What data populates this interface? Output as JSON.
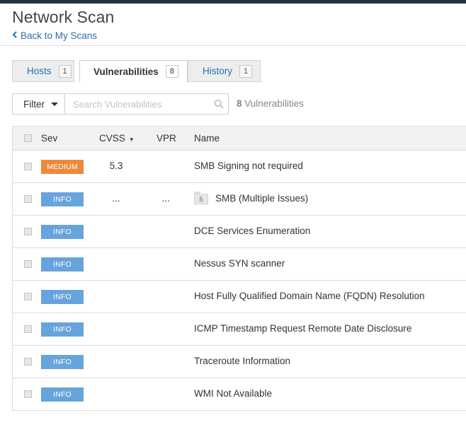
{
  "page": {
    "title": "Network Scan",
    "back_link": "Back to My Scans"
  },
  "tabs": [
    {
      "label": "Hosts",
      "count": "1",
      "active": false
    },
    {
      "label": "Vulnerabilities",
      "count": "8",
      "active": true
    },
    {
      "label": "History",
      "count": "1",
      "active": false
    }
  ],
  "toolbar": {
    "filter_label": "Filter",
    "search_placeholder": "Search Vulnerabilities",
    "count_number": "8",
    "count_label": "Vulnerabilities"
  },
  "table": {
    "headers": {
      "sev": "Sev",
      "cvss": "CVSS",
      "vpr": "VPR",
      "name": "Name"
    },
    "sort_indicator": "▾",
    "rows": [
      {
        "severity": "MEDIUM",
        "cvss": "5.3",
        "vpr": "",
        "name": "SMB Signing not required"
      },
      {
        "severity": "INFO",
        "cvss": "...",
        "vpr": "...",
        "group_count": "5",
        "name": "SMB (Multiple Issues)"
      },
      {
        "severity": "INFO",
        "cvss": "",
        "vpr": "",
        "name": "DCE Services Enumeration"
      },
      {
        "severity": "INFO",
        "cvss": "",
        "vpr": "",
        "name": "Nessus SYN scanner"
      },
      {
        "severity": "INFO",
        "cvss": "",
        "vpr": "",
        "name": "Host Fully Qualified Domain Name (FQDN) Resolution"
      },
      {
        "severity": "INFO",
        "cvss": "",
        "vpr": "",
        "name": "ICMP Timestamp Request Remote Date Disclosure"
      },
      {
        "severity": "INFO",
        "cvss": "",
        "vpr": "",
        "name": "Traceroute Information"
      },
      {
        "severity": "INFO",
        "cvss": "",
        "vpr": "",
        "name": "WMI Not Available"
      }
    ]
  },
  "colors": {
    "medium": "#f0883a",
    "info": "#67a4dc",
    "link": "#2a6fb0",
    "topbar": "#263340"
  },
  "icons": {
    "back": "chevron-left-icon",
    "search": "search-icon",
    "filter_caret": "caret-down-icon",
    "group": "folder-icon"
  }
}
